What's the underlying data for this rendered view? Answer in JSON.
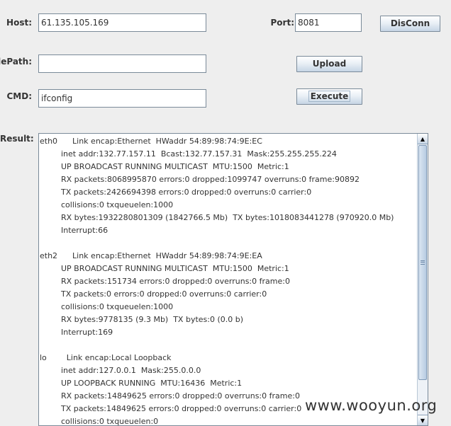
{
  "form": {
    "host_label": "Host:",
    "host_value": "61.135.105.169",
    "port_label": "Port:",
    "port_value": "8081",
    "disconnect_label": "DisConn",
    "filepath_label": "FilePath:",
    "filepath_value": "",
    "upload_label": "Upload",
    "cmd_label": "CMD:",
    "cmd_value": "ifconfig",
    "execute_label": "Execute",
    "result_label": "Result:"
  },
  "result": {
    "lines": [
      "eth0      Link encap:Ethernet  HWaddr 54:89:98:74:9E:EC",
      "inet addr:132.77.157.11  Bcast:132.77.157.31  Mask:255.255.255.224",
      "UP BROADCAST RUNNING MULTICAST  MTU:1500  Metric:1",
      "RX packets:8068995870 errors:0 dropped:1099747 overruns:0 frame:90892",
      "TX packets:2426694398 errors:0 dropped:0 overruns:0 carrier:0",
      "collisions:0 txqueuelen:1000",
      "RX bytes:1932280801309 (1842766.5 Mb)  TX bytes:1018083441278 (970920.0 Mb)",
      "Interrupt:66",
      "",
      "eth2      Link encap:Ethernet  HWaddr 54:89:98:74:9E:EA",
      "UP BROADCAST RUNNING MULTICAST  MTU:1500  Metric:1",
      "RX packets:151734 errors:0 dropped:0 overruns:0 frame:0",
      "TX packets:0 errors:0 dropped:0 overruns:0 carrier:0",
      "collisions:0 txqueuelen:1000",
      "RX bytes:9778135 (9.3 Mb)  TX bytes:0 (0.0 b)",
      "Interrupt:169",
      "",
      "lo        Link encap:Local Loopback",
      "inet addr:127.0.0.1  Mask:255.0.0.0",
      "UP LOOPBACK RUNNING  MTU:16436  Metric:1",
      "RX packets:14849625 errors:0 dropped:0 overruns:0 frame:0",
      "TX packets:14849625 errors:0 dropped:0 overruns:0 carrier:0",
      "collisions:0 txqueuelen:0"
    ]
  },
  "scrollbar": {
    "up_icon": "arrow-up-icon",
    "down_icon": "arrow-down-icon"
  },
  "watermark": "www.wooyun.org",
  "colors": {
    "background": "#eeeeee",
    "field_border": "#7a8a99",
    "button_gradient_bottom": "#c6d5e5"
  }
}
